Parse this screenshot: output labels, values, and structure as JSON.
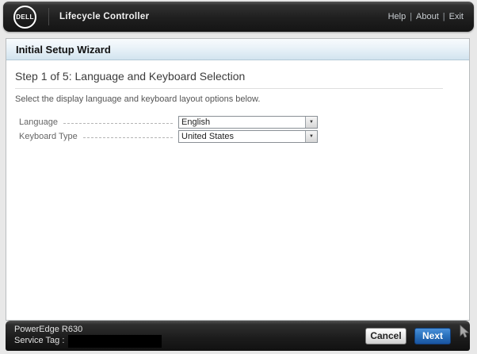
{
  "header": {
    "logo": "DELL",
    "app_title": "Lifecycle Controller",
    "links": [
      {
        "label": "Help"
      },
      {
        "label": "About"
      },
      {
        "label": "Exit"
      }
    ],
    "separator": "|"
  },
  "wizard": {
    "title": "Initial Setup Wizard",
    "step_heading": "Step 1 of 5: Language and Keyboard Selection",
    "instruction": "Select the display language and keyboard layout options below.",
    "fields": [
      {
        "label": "Language",
        "value": "English"
      },
      {
        "label": "Keyboard Type",
        "value": "United States"
      }
    ]
  },
  "footer": {
    "model": "PowerEdge R630",
    "service_tag_label": "Service Tag :",
    "cancel_label": "Cancel",
    "next_label": "Next"
  },
  "icons": [
    {
      "name": "combo-arrow-icon",
      "glyph": "▼"
    }
  ],
  "colors": {
    "header_dark": "#1f1f1f",
    "titlebar_blue": "#d2e4ef",
    "next_button_blue": "#2a72bd",
    "content_background": "#ffffff",
    "page_background": "#e8e8e8"
  }
}
